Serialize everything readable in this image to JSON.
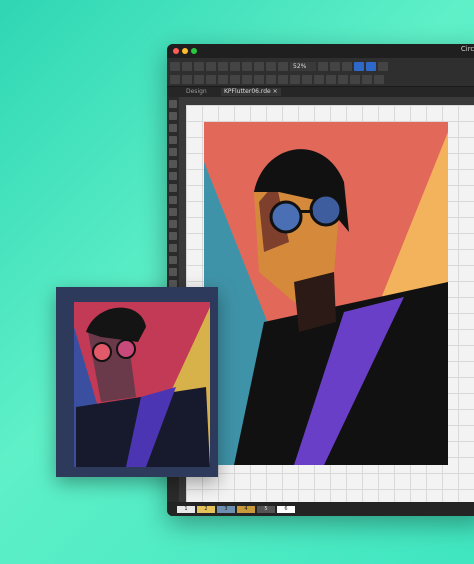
{
  "app": {
    "title": "Circon",
    "zoom": "52%",
    "tabs": [
      {
        "label": "Design"
      },
      {
        "label": "KPFlutter06.rde"
      }
    ],
    "close_icon": "×",
    "status_chips": [
      "1",
      "2",
      "3",
      "4",
      "5",
      "6"
    ],
    "chip_colors": [
      "#e8e8e8",
      "#e6c25a",
      "#6d8fb0",
      "#c99a3a",
      "#555555",
      "#ffffff"
    ]
  },
  "icons": [
    "apple-menu-icon",
    "select-tool-icon",
    "pen-tool-icon",
    "zoom-icon",
    "text-tool-icon",
    "shape-tool-icon",
    "layers-icon"
  ],
  "colors": {
    "background": "#3fe6c0",
    "art_red": "#e2685a",
    "art_orange": "#f3b25c",
    "art_teal": "#3f93a8",
    "art_purple": "#6a3fc7"
  }
}
